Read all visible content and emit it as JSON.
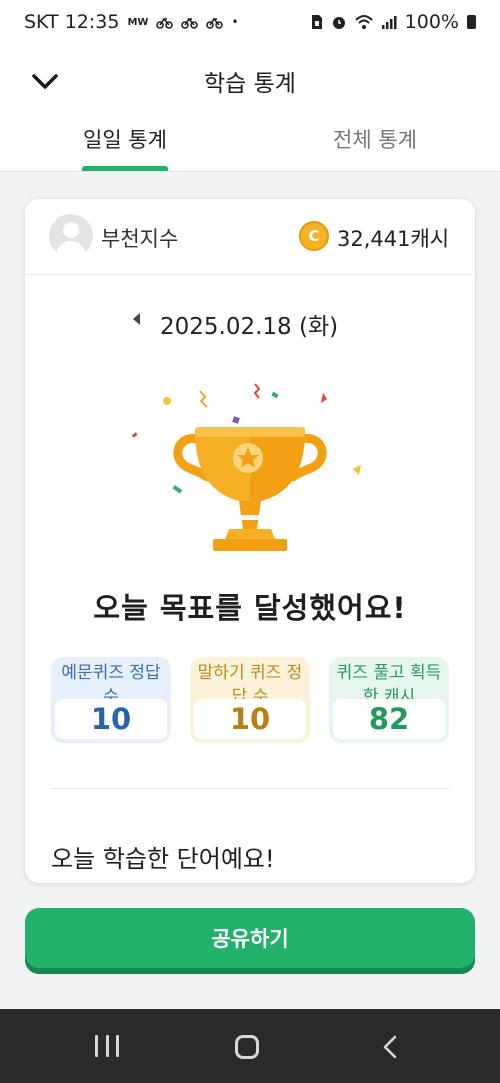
{
  "status_bar": {
    "carrier_time": "SKT 12:35",
    "mini_text": "MW",
    "dot": "•",
    "battery_text": "100%",
    "icons": [
      "nmw-icon",
      "bike-icon",
      "bike-icon",
      "bike-icon",
      "sim-icon",
      "alarm-icon",
      "wifi-icon",
      "signal-icon",
      "battery-icon"
    ]
  },
  "header": {
    "title": "학습 통계",
    "back_icon": "chevron-down-icon",
    "tabs": [
      {
        "label": "일일 통계",
        "active": true
      },
      {
        "label": "전체 통계",
        "active": false
      }
    ]
  },
  "profile": {
    "username": "부천지수",
    "cash": "32,441캐시",
    "coin_symbol": "C"
  },
  "date": {
    "text": "2025.02.18 (화)",
    "prev_icon": "caret-left-icon"
  },
  "achievement": {
    "message": "오늘 목표를 달성했어요!",
    "icon": "trophy-icon"
  },
  "stats": [
    {
      "label": "예문퀴즈 정답 수",
      "value": "10",
      "color": "#2b62ad"
    },
    {
      "label": "말하기 퀴즈 정답 수",
      "value": "10",
      "color": "#b58116"
    },
    {
      "label": "퀴즈 풀고 획득한 캐시",
      "value": "82",
      "color": "#20995a"
    }
  ],
  "words_section": {
    "title": "오늘 학습한 단어예요!"
  },
  "share_button": {
    "label": "공유하기"
  },
  "colors": {
    "accent": "#22b16a",
    "background": "#f2f3f5",
    "nav_bar": "#2a2a2a"
  },
  "nav_bar": {
    "icons": [
      "recent-apps-icon",
      "home-icon",
      "back-icon"
    ]
  }
}
